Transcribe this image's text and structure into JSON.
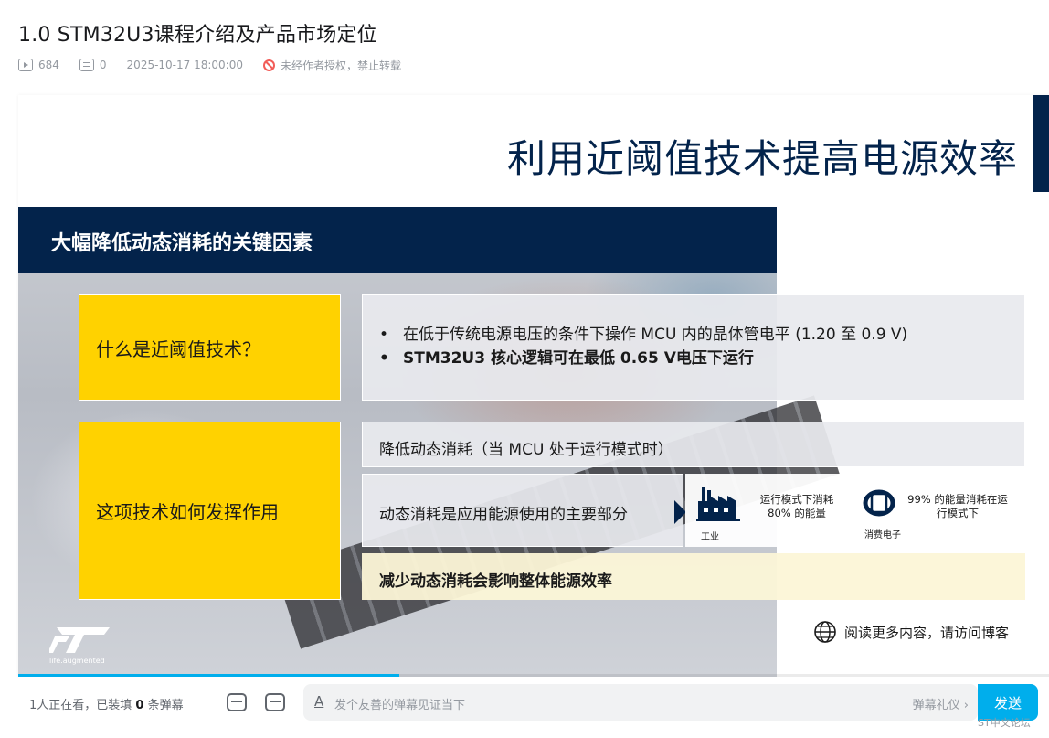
{
  "video": {
    "title": "1.0 STM32U3课程介绍及产品市场定位",
    "views": "684",
    "danmaku_count": "0",
    "date": "2025-10-17 18:00:00",
    "copyright": "未经作者授权，禁止转载"
  },
  "slide": {
    "title": "利用近阈值技术提高电源效率",
    "band": "大幅降低动态消耗的关键因素",
    "q1": "什么是近阈值技术？",
    "q1_points": [
      "在低于传统电源电压的条件下操作  MCU  内的晶体管电平 (1.20 至 0.9 V)",
      "STM32U3  核心逻辑可在最低 0.65 V电压下运行"
    ],
    "q2": "这项技术如何发挥作用",
    "row1": "降低动态消耗（当  MCU  处于运行模式时）",
    "row2": "动态消耗是应用能源使用的主要部分",
    "industry_stat": "运行模式下消耗\n80% 的能量",
    "industry_label": "工业",
    "consumer_stat": "99% 的能量消耗在运\n行模式下",
    "consumer_label": "消费电子",
    "row3": "减少动态消耗会影响整体能源效率",
    "logo_tagline": "life.augmented",
    "read_more": "阅读更多内容，请访问博客",
    "bullet": "•"
  },
  "danmaku_bar": {
    "viewers_pre": "1人正在看，已装填 ",
    "viewers_num": "0",
    "viewers_post": " 条弹幕",
    "input_icon": "A",
    "placeholder": "发个友善的弹幕见证当下",
    "etiquette": "弹幕礼仪 ›",
    "send": "发送"
  },
  "forum_label": "ST中文论坛",
  "progress": 0.37,
  "colors": {
    "navy": "#03234b",
    "yellow": "#ffd200",
    "accent": "#00aeec"
  }
}
